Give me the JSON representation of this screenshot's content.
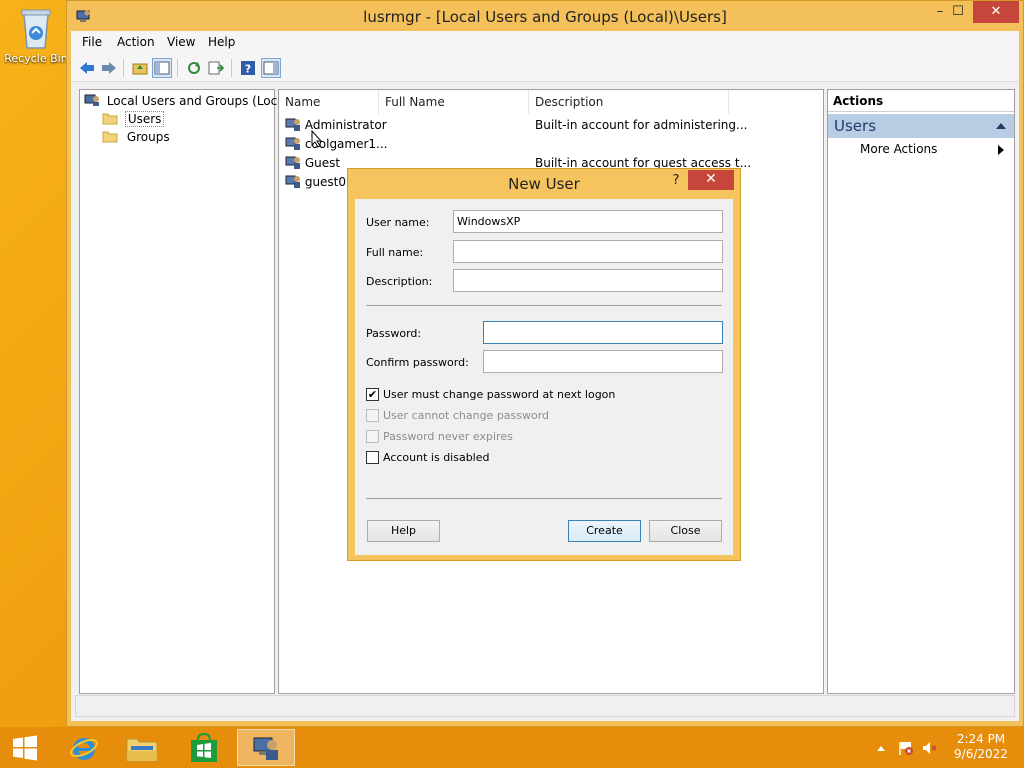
{
  "desktop": {
    "recycle_bin_label": "Recycle Bin"
  },
  "window": {
    "title": "lusrmgr - [Local Users and Groups (Local)\\Users]",
    "controls": {
      "minimize": "–",
      "maximize": "☐",
      "close": "✕"
    }
  },
  "menubar": {
    "items": [
      "File",
      "Action",
      "View",
      "Help"
    ]
  },
  "tree": {
    "root": "Local Users and Groups (Local)",
    "children": [
      "Users",
      "Groups"
    ]
  },
  "list": {
    "columns": [
      "Name",
      "Full Name",
      "Description"
    ],
    "rows": [
      {
        "name": "Administrator",
        "full_name": "",
        "description": "Built-in account for administering..."
      },
      {
        "name": "coolgamer1...",
        "full_name": "",
        "description": ""
      },
      {
        "name": "Guest",
        "full_name": "",
        "description": "Built-in account for guest access t..."
      },
      {
        "name": "guest0",
        "full_name": "",
        "description": ""
      }
    ]
  },
  "actions": {
    "header": "Actions",
    "section": "Users",
    "more": "More Actions"
  },
  "dialog": {
    "title": "New User",
    "help_glyph": "?",
    "close_glyph": "✕",
    "fields": {
      "username_label": "User name:",
      "username_value": "WindowsXP",
      "fullname_label": "Full name:",
      "fullname_value": "",
      "description_label": "Description:",
      "description_value": "",
      "password_label": "Password:",
      "password_value": "",
      "confirm_label": "Confirm password:",
      "confirm_value": ""
    },
    "checkboxes": [
      {
        "label": "User must change password at next logon",
        "checked": true,
        "enabled": true
      },
      {
        "label": "User cannot change password",
        "checked": false,
        "enabled": false
      },
      {
        "label": "Password never expires",
        "checked": false,
        "enabled": false
      },
      {
        "label": "Account is disabled",
        "checked": false,
        "enabled": true
      }
    ],
    "buttons": {
      "help": "Help",
      "create": "Create",
      "close": "Close"
    }
  },
  "taskbar": {
    "time": "2:24 PM",
    "date": "9/6/2022"
  },
  "colors": {
    "desktop": "#f0a00f",
    "window_frame": "#f4c05a",
    "close_button": "#c7463b",
    "taskbar": "#e68d0c",
    "actions_section": "#b8cde4"
  }
}
